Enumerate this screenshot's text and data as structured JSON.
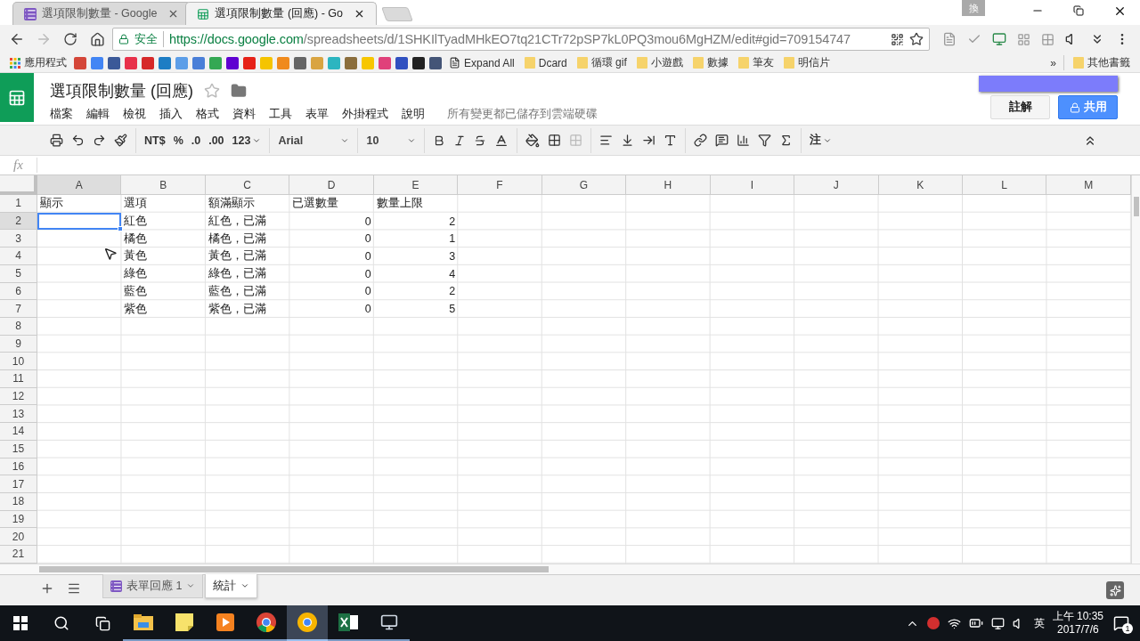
{
  "browser": {
    "tabs": [
      {
        "title": "選項限制數量 - Google",
        "kind": "form",
        "selected": false
      },
      {
        "title": "選項限制數量 (回應) - Go",
        "kind": "sheet",
        "selected": true
      }
    ],
    "ime_key": "換",
    "address": {
      "security": "安全",
      "host": "https://docs.google.com",
      "path": "/spreadsheets/d/1SHKIlTyadMHkEO7tq21CTr72pSP7kL0PQ3mou6MgHZM/edit#gid=709154747"
    },
    "bookmarks": [
      {
        "kind": "apps",
        "label": "應用程式"
      },
      {
        "kind": "favicon",
        "color": "#d44638"
      },
      {
        "kind": "favicon",
        "color": "#4285f4"
      },
      {
        "kind": "favicon",
        "color": "#3b5998"
      },
      {
        "kind": "favicon",
        "color": "#e8304a"
      },
      {
        "kind": "favicon",
        "color": "#d62828"
      },
      {
        "kind": "favicon",
        "color": "#1d7dc4"
      },
      {
        "kind": "favicon",
        "color": "#5c9ee8"
      },
      {
        "kind": "favicon",
        "color": "#4a7fd8"
      },
      {
        "kind": "favicon",
        "color": "#34a853"
      },
      {
        "kind": "favicon",
        "color": "#5f01d1"
      },
      {
        "kind": "favicon",
        "color": "#e62117"
      },
      {
        "kind": "favicon",
        "color": "#f5c400"
      },
      {
        "kind": "favicon",
        "color": "#f08a1c"
      },
      {
        "kind": "favicon",
        "color": "#666666"
      },
      {
        "kind": "favicon",
        "color": "#d9a441"
      },
      {
        "kind": "favicon",
        "color": "#2cb5c0"
      },
      {
        "kind": "favicon",
        "color": "#8b6e3c"
      },
      {
        "kind": "favicon",
        "color": "#f7c600"
      },
      {
        "kind": "favicon",
        "color": "#e0407a"
      },
      {
        "kind": "favicon",
        "color": "#3050c0"
      },
      {
        "kind": "favicon",
        "color": "#222222"
      },
      {
        "kind": "favicon",
        "color": "#445577"
      },
      {
        "kind": "page",
        "label": "Expand All"
      },
      {
        "kind": "folder",
        "label": "Dcard"
      },
      {
        "kind": "folder",
        "label": "循環 gif"
      },
      {
        "kind": "folder",
        "label": "小遊戲"
      },
      {
        "kind": "folder",
        "label": "數據"
      },
      {
        "kind": "folder",
        "label": "筆友"
      },
      {
        "kind": "folder",
        "label": "明信片"
      }
    ],
    "overflow": "»",
    "other_bookmarks": "其他書籤"
  },
  "sheets": {
    "title": "選項限制數量 (回應)",
    "menu": [
      "檔案",
      "編輯",
      "檢視",
      "插入",
      "格式",
      "資料",
      "工具",
      "表單",
      "外掛程式",
      "說明"
    ],
    "save_status": "所有變更都已儲存到雲端硬碟",
    "comment_button": "註解",
    "share_button": "共用",
    "toolbar": {
      "currency": "NT$",
      "percent": "%",
      "decrease_decimal": ".0",
      "increase_decimal": ".00",
      "number_format": "123",
      "font": "Arial",
      "font_size": "10",
      "note": "注"
    },
    "formula_label": "fx",
    "columns": [
      {
        "label": "A",
        "selected": true
      },
      {
        "label": "B",
        "selected": false
      },
      {
        "label": "C",
        "selected": false
      },
      {
        "label": "D",
        "selected": false
      },
      {
        "label": "E",
        "selected": false
      },
      {
        "label": "F",
        "selected": false
      },
      {
        "label": "G",
        "selected": false
      },
      {
        "label": "H",
        "selected": false
      },
      {
        "label": "I",
        "selected": false
      },
      {
        "label": "J",
        "selected": false
      },
      {
        "label": "K",
        "selected": false
      },
      {
        "label": "L",
        "selected": false
      },
      {
        "label": "M",
        "selected": false
      }
    ],
    "rows": [
      {
        "number": "1",
        "selected": false,
        "cells": [
          {
            "text": "顯示",
            "kind": "text"
          },
          {
            "text": "選項",
            "kind": "text"
          },
          {
            "text": "額滿顯示",
            "kind": "text"
          },
          {
            "text": "已選數量",
            "kind": "text"
          },
          {
            "text": "數量上限",
            "kind": "text"
          }
        ]
      },
      {
        "number": "2",
        "selected": true,
        "cells": [
          null,
          {
            "text": "紅色",
            "kind": "text"
          },
          {
            "text": "紅色，已滿",
            "kind": "text"
          },
          {
            "text": "0",
            "kind": "number"
          },
          {
            "text": "2",
            "kind": "number"
          }
        ]
      },
      {
        "number": "3",
        "selected": false,
        "cells": [
          null,
          {
            "text": "橘色",
            "kind": "text"
          },
          {
            "text": "橘色，已滿",
            "kind": "text"
          },
          {
            "text": "0",
            "kind": "number"
          },
          {
            "text": "1",
            "kind": "number"
          }
        ]
      },
      {
        "number": "4",
        "selected": false,
        "cells": [
          null,
          {
            "text": "黃色",
            "kind": "text"
          },
          {
            "text": "黃色，已滿",
            "kind": "text"
          },
          {
            "text": "0",
            "kind": "number"
          },
          {
            "text": "3",
            "kind": "number"
          }
        ]
      },
      {
        "number": "5",
        "selected": false,
        "cells": [
          null,
          {
            "text": "綠色",
            "kind": "text"
          },
          {
            "text": "綠色，已滿",
            "kind": "text"
          },
          {
            "text": "0",
            "kind": "number"
          },
          {
            "text": "4",
            "kind": "number"
          }
        ]
      },
      {
        "number": "6",
        "selected": false,
        "cells": [
          null,
          {
            "text": "藍色",
            "kind": "text"
          },
          {
            "text": "藍色，已滿",
            "kind": "text"
          },
          {
            "text": "0",
            "kind": "number"
          },
          {
            "text": "2",
            "kind": "number"
          }
        ]
      },
      {
        "number": "7",
        "selected": false,
        "cells": [
          null,
          {
            "text": "紫色",
            "kind": "text"
          },
          {
            "text": "紫色，已滿",
            "kind": "text"
          },
          {
            "text": "0",
            "kind": "number"
          },
          {
            "text": "5",
            "kind": "number"
          }
        ]
      },
      {
        "number": "8",
        "selected": false
      },
      {
        "number": "9",
        "selected": false
      },
      {
        "number": "10",
        "selected": false
      },
      {
        "number": "11",
        "selected": false
      },
      {
        "number": "12",
        "selected": false
      },
      {
        "number": "13",
        "selected": false
      },
      {
        "number": "14",
        "selected": false
      },
      {
        "number": "15",
        "selected": false
      },
      {
        "number": "16",
        "selected": false
      },
      {
        "number": "17",
        "selected": false
      },
      {
        "number": "18",
        "selected": false
      },
      {
        "number": "19",
        "selected": false
      },
      {
        "number": "20",
        "selected": false
      },
      {
        "number": "21",
        "selected": false
      }
    ],
    "sheet_tabs": [
      {
        "label": "表單回應 1",
        "kind": "form",
        "selected": false
      },
      {
        "label": "統計",
        "kind": "plain",
        "selected": true
      }
    ]
  },
  "taskbar": {
    "apps": [
      {
        "kind": "explorer",
        "selected": false
      },
      {
        "kind": "notes",
        "selected": false
      },
      {
        "kind": "player",
        "selected": false
      },
      {
        "kind": "chrome",
        "selected": false
      },
      {
        "kind": "canary",
        "selected": true
      },
      {
        "kind": "excel",
        "selected": false
      },
      {
        "kind": "monitor",
        "selected": false
      }
    ],
    "ime": "英",
    "time": "上午 10:35",
    "date": "2017/7/6",
    "notifications": "1"
  }
}
